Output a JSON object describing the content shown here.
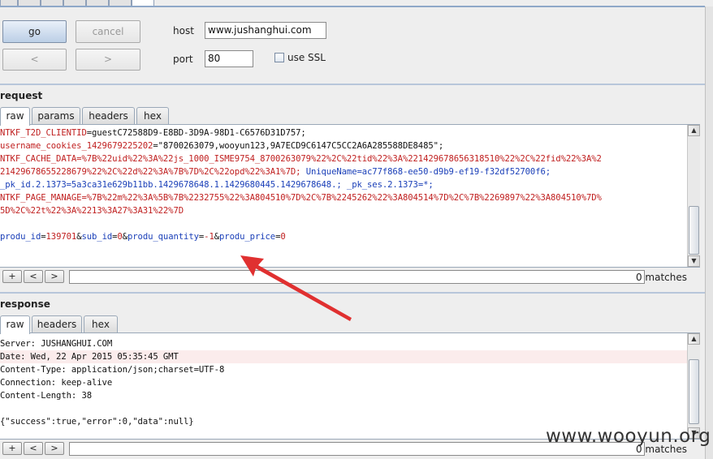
{
  "toolbar": {
    "go_label": "go",
    "cancel_label": "cancel",
    "back_label": "<",
    "forward_label": ">",
    "host_label": "host",
    "host_value": "www.jushanghui.com",
    "port_label": "port",
    "port_value": "80",
    "ssl_label": "use SSL",
    "ssl_checked": false
  },
  "request": {
    "title": "request",
    "tabs": [
      {
        "label": "raw",
        "active": true
      },
      {
        "label": "params",
        "active": false
      },
      {
        "label": "headers",
        "active": false
      },
      {
        "label": "hex",
        "active": false
      }
    ],
    "lines": [
      {
        "segments": [
          {
            "text": "NTKF_T2D_CLIENTID",
            "color": "red"
          },
          {
            "text": "=guestC72588D9-E8BD-3D9A-98D1-C6576D31D757;",
            "color": "blk"
          }
        ]
      },
      {
        "segments": [
          {
            "text": "username_cookies_1429679225202",
            "color": "red"
          },
          {
            "text": "=\"8700263079,wooyun123,9A7ECD9C6147C5CC2A6A285588DE8485\";",
            "color": "blk"
          }
        ]
      },
      {
        "segments": [
          {
            "text": "NTKF_CACHE_DATA",
            "color": "red"
          },
          {
            "text": "=%7B%22uid%22%3A%22js_1000_ISME9754_8700263079%22%2C%22tid%22%3A%221429678656318510%22%2C%22fid%22%3A%2",
            "color": "red"
          }
        ]
      },
      {
        "segments": [
          {
            "text": "21429678655228679%22%2C%22d%22%3A%7B%7D%2C%22opd%22%3A1%7D;",
            "color": "red"
          },
          {
            "text": " ",
            "color": "blk"
          },
          {
            "text": "UniqueName",
            "color": "blue"
          },
          {
            "text": "=ac77f868-ee50-d9b9-ef19-f32df52700f6;",
            "color": "blue"
          }
        ]
      },
      {
        "segments": [
          {
            "text": "_pk_id.2.1373",
            "color": "blue"
          },
          {
            "text": "=5a3ca31e629b11bb.1429678648.1.1429680445.1429678648.;",
            "color": "blue"
          },
          {
            "text": " ",
            "color": "blk"
          },
          {
            "text": "_pk_ses.2.1373",
            "color": "blue"
          },
          {
            "text": "=*;",
            "color": "blue"
          }
        ]
      },
      {
        "segments": [
          {
            "text": "NTKF_PAGE_MANAGE",
            "color": "red"
          },
          {
            "text": "=%7B%22m%22%3A%5B%7B%2232755%22%3A804510%7D%2C%7B%2245262%22%3A804514%7D%2C%7B%2269897%22%3A804510%7D%",
            "color": "red"
          }
        ]
      },
      {
        "segments": [
          {
            "text": "5D%2C%22t%22%3A%2213%3A27%3A31%22%7D",
            "color": "red"
          }
        ]
      },
      {
        "segments": [
          {
            "text": "",
            "color": "blk"
          }
        ]
      },
      {
        "segments": [
          {
            "text": "produ_id",
            "color": "blue"
          },
          {
            "text": "=",
            "color": "blk"
          },
          {
            "text": "139701",
            "color": "red"
          },
          {
            "text": "&",
            "color": "blk"
          },
          {
            "text": "sub_id",
            "color": "blue"
          },
          {
            "text": "=",
            "color": "blk"
          },
          {
            "text": "0",
            "color": "red"
          },
          {
            "text": "&",
            "color": "blk"
          },
          {
            "text": "produ_quantity",
            "color": "blue"
          },
          {
            "text": "=",
            "color": "blk"
          },
          {
            "text": "-1",
            "color": "red"
          },
          {
            "text": "&",
            "color": "blk"
          },
          {
            "text": "produ_price",
            "color": "blue"
          },
          {
            "text": "=",
            "color": "blk"
          },
          {
            "text": "0",
            "color": "red"
          }
        ]
      }
    ],
    "find": {
      "prev": "+",
      "back": "<",
      "next": ">",
      "matches": "0 matches"
    }
  },
  "response": {
    "title": "response",
    "tabs": [
      {
        "label": "raw",
        "active": true
      },
      {
        "label": "headers",
        "active": false
      },
      {
        "label": "hex",
        "active": false
      }
    ],
    "lines": [
      {
        "text": "Server: JUSHANGHUI.COM",
        "highlight": false
      },
      {
        "text": "Date: Wed, 22 Apr 2015 05:35:45 GMT",
        "highlight": true
      },
      {
        "text": "Content-Type: application/json;charset=UTF-8",
        "highlight": false
      },
      {
        "text": "Connection: keep-alive",
        "highlight": false
      },
      {
        "text": "Content-Length: 38",
        "highlight": false
      },
      {
        "text": "",
        "highlight": false
      },
      {
        "text": "{\"success\":true,\"error\":0,\"data\":null}",
        "highlight": false
      }
    ],
    "find": {
      "prev": "+",
      "back": "<",
      "next": ">",
      "matches": "0 matches"
    }
  },
  "annotation": {
    "arrow_color": "#e03030"
  },
  "watermark": "www.wooyun.org",
  "colors": {
    "param_name": "#1a3fb8",
    "param_value": "#c02020",
    "selection": "#fbecec"
  }
}
